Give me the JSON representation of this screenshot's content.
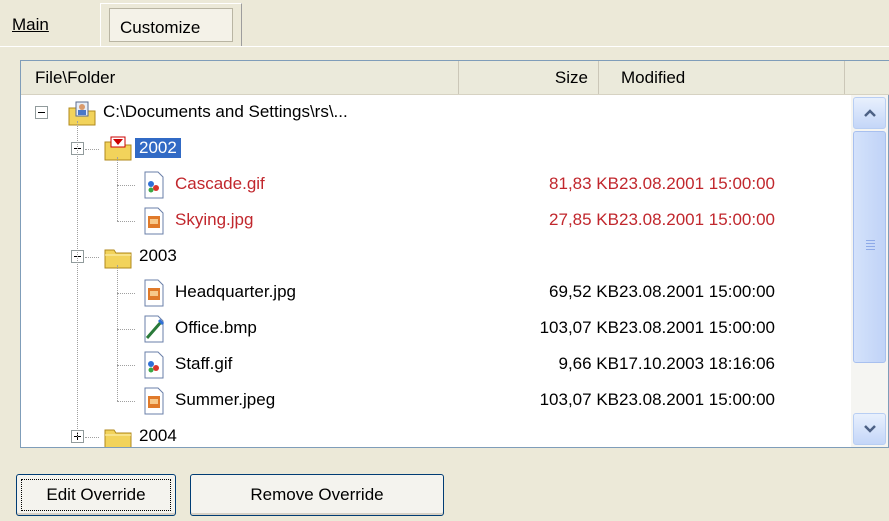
{
  "tabs": {
    "main_label": "Main",
    "customize_label": "Customize"
  },
  "columns": {
    "file": "File\\Folder",
    "size": "Size",
    "modified": "Modified"
  },
  "tree": {
    "root": {
      "label": "C:\\Documents and Settings\\rs\\...",
      "icon": "user-folder-icon",
      "expanded": true
    },
    "folders": [
      {
        "label": "2002",
        "icon": "folder-override-icon",
        "expanded": true,
        "selected": true,
        "items": [
          {
            "name": "Cascade.gif",
            "size": "81,83 KB",
            "modified": "23.08.2001 15:00:00",
            "icon": "gif-file-icon",
            "highlight": true
          },
          {
            "name": "Skying.jpg",
            "size": "27,85 KB",
            "modified": "23.08.2001 15:00:00",
            "icon": "jpg-file-icon",
            "highlight": true
          }
        ]
      },
      {
        "label": "2003",
        "icon": "folder-icon",
        "expanded": true,
        "selected": false,
        "items": [
          {
            "name": "Headquarter.jpg",
            "size": "69,52 KB",
            "modified": "23.08.2001 15:00:00",
            "icon": "jpg-file-icon",
            "highlight": false
          },
          {
            "name": "Office.bmp",
            "size": "103,07 KB",
            "modified": "23.08.2001 15:00:00",
            "icon": "bmp-file-icon",
            "highlight": false
          },
          {
            "name": "Staff.gif",
            "size": "9,66 KB",
            "modified": "17.10.2003 18:16:06",
            "icon": "gif-file-icon",
            "highlight": false
          },
          {
            "name": "Summer.jpeg",
            "size": "103,07 KB",
            "modified": "23.08.2001 15:00:00",
            "icon": "jpg-file-icon",
            "highlight": false
          }
        ]
      },
      {
        "label": "2004",
        "icon": "folder-icon",
        "expanded": false,
        "selected": false,
        "items": []
      }
    ]
  },
  "buttons": {
    "edit_override": "Edit Override",
    "remove_override": "Remove Override"
  },
  "colors": {
    "highlight_text": "#C1272D",
    "selection": "#316AC5",
    "folder": "#F2D35B"
  }
}
